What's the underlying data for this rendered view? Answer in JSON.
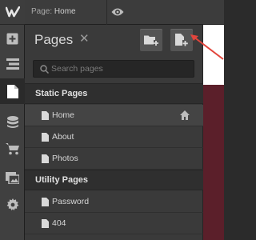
{
  "topbar": {
    "page_key": "Page:",
    "page_value": "Home"
  },
  "panel": {
    "title": "Pages",
    "search_placeholder": "Search pages",
    "sections": [
      {
        "label": "Static Pages"
      },
      {
        "label": "Utility Pages"
      }
    ],
    "static_pages": [
      {
        "label": "Home",
        "selected": true,
        "is_homepage": true
      },
      {
        "label": "About"
      },
      {
        "label": "Photos"
      }
    ],
    "utility_pages": [
      {
        "label": "Password"
      },
      {
        "label": "404"
      }
    ]
  },
  "rail": {
    "icons": [
      "webflow-logo-icon",
      "add-panel-icon",
      "navigator-icon",
      "pages-icon",
      "cms-icon",
      "ecommerce-icon",
      "assets-icon",
      "settings-icon"
    ]
  },
  "colors": {
    "annotation_arrow": "#e2453c",
    "canvas_band": "#5b1f2a"
  }
}
